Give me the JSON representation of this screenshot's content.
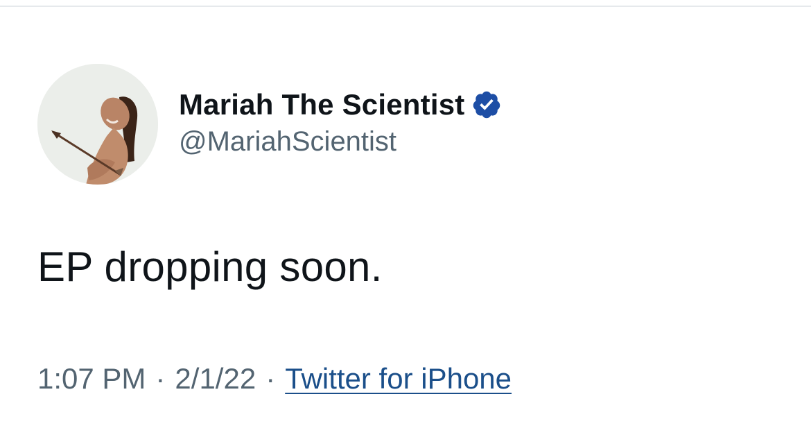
{
  "tweet": {
    "author": {
      "display_name": "Mariah The Scientist",
      "handle": "@MariahScientist",
      "verified": true,
      "avatar_icon": "profile-photo"
    },
    "text": "EP dropping soon.",
    "time": "1:07 PM",
    "separator": "·",
    "date": "2/1/22",
    "source": "Twitter for iPhone"
  },
  "colors": {
    "name": "#0f1419",
    "secondary": "#536471",
    "verified": "#1d4ea5",
    "link": "#1b4f8a"
  }
}
